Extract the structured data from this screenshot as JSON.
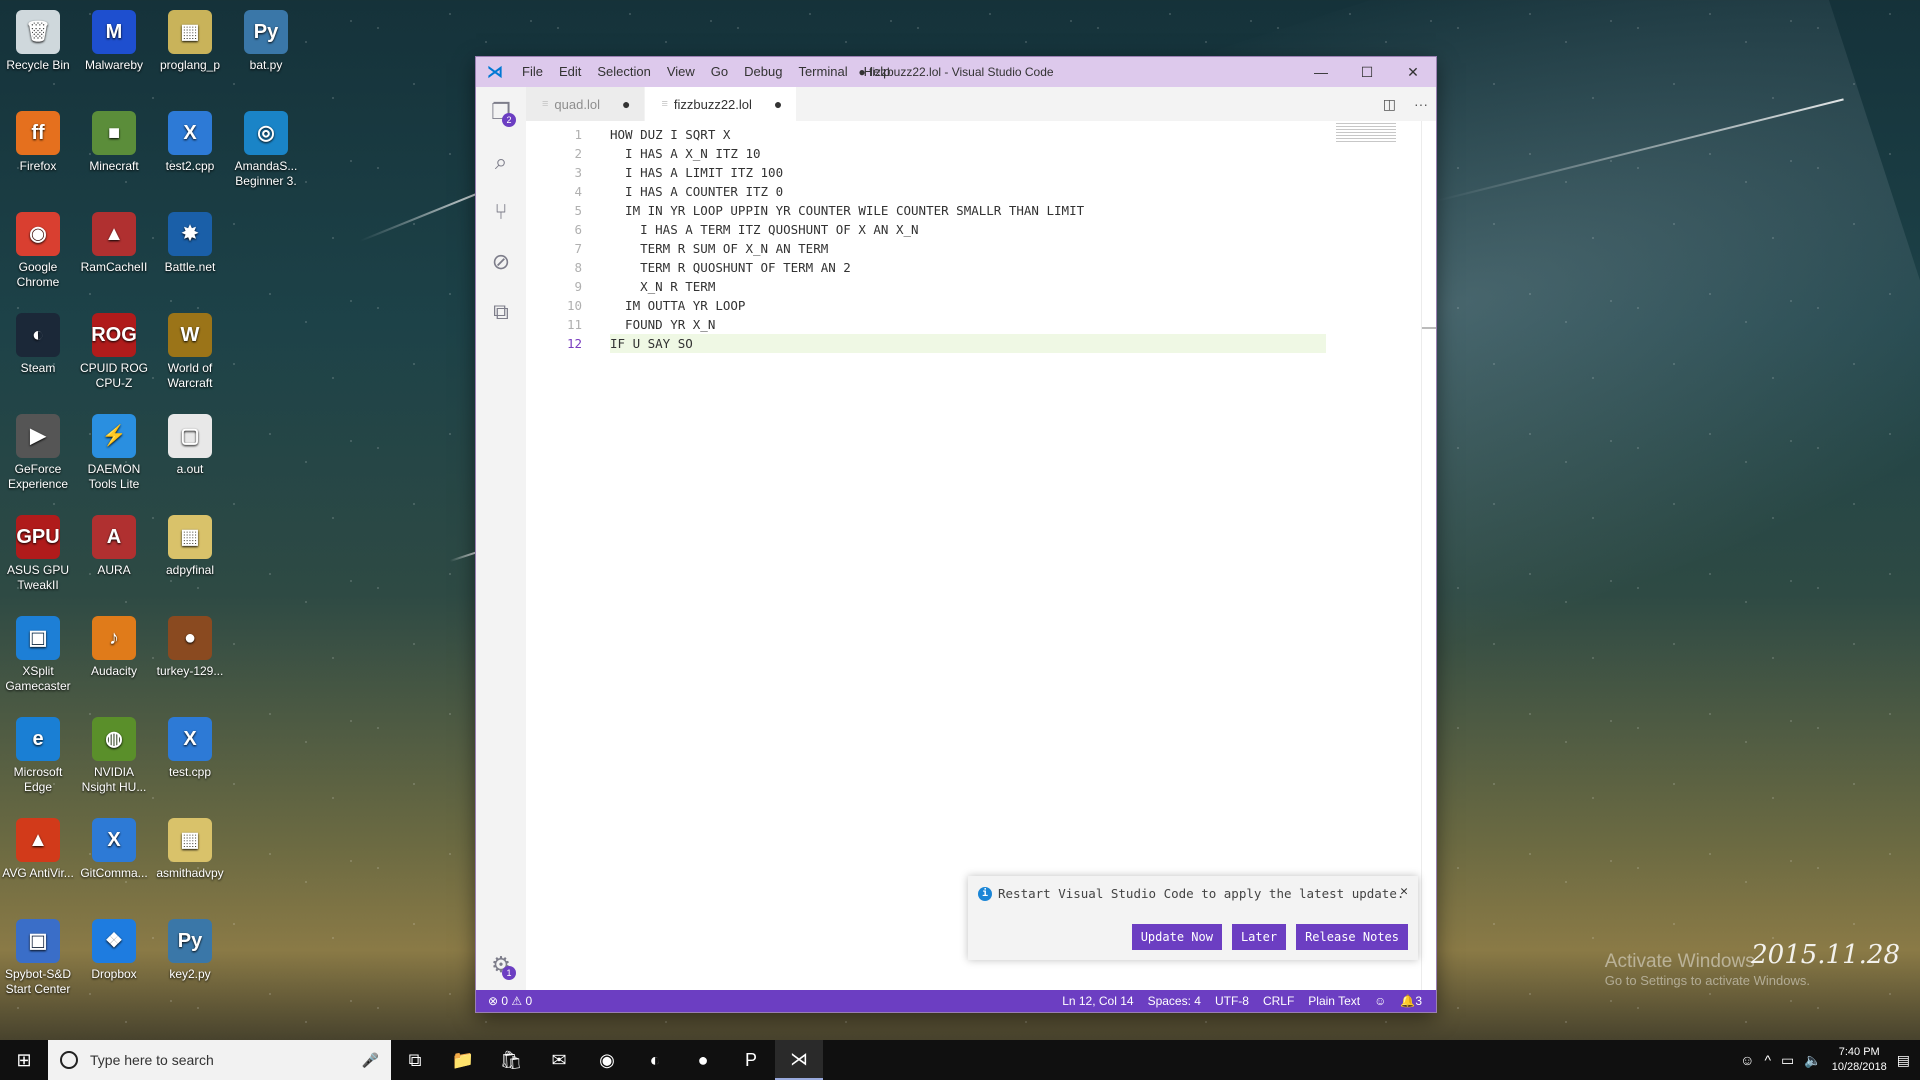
{
  "desktop": {
    "icons": [
      {
        "label": "Recycle Bin",
        "glyph": "🗑",
        "color": "#cfd8dc"
      },
      {
        "label": "Malwareby",
        "glyph": "M",
        "color": "#1e4fcf"
      },
      {
        "label": "proglang_p",
        "glyph": "▦",
        "color": "#c9b35a"
      },
      {
        "label": "bat.py",
        "glyph": "Py",
        "color": "#3a77a8"
      },
      {
        "label": "Firefox",
        "glyph": "ff",
        "color": "#e5701e"
      },
      {
        "label": "Minecraft",
        "glyph": "■",
        "color": "#5b8d3a"
      },
      {
        "label": "test2.cpp",
        "glyph": "X",
        "color": "#2d7ad6"
      },
      {
        "label": "AmandaS... Beginner 3.",
        "glyph": "◎",
        "color": "#1a84c7"
      },
      {
        "label": "Google Chrome",
        "glyph": "◉",
        "color": "#d93f30"
      },
      {
        "label": "RamCacheII",
        "glyph": "▲",
        "color": "#b03030"
      },
      {
        "label": "Battle.net",
        "glyph": "✸",
        "color": "#1a5fa8"
      },
      {
        "label": "",
        "glyph": "",
        "color": "transparent"
      },
      {
        "label": "Steam",
        "glyph": "◐",
        "color": "#1b2838"
      },
      {
        "label": "CPUID ROG CPU-Z",
        "glyph": "ROG",
        "color": "#b01b1b"
      },
      {
        "label": "World of Warcraft",
        "glyph": "W",
        "color": "#9b7418"
      },
      {
        "label": "",
        "glyph": "",
        "color": "transparent"
      },
      {
        "label": "GeForce Experience",
        "glyph": "▶",
        "color": "#555"
      },
      {
        "label": "DAEMON Tools Lite",
        "glyph": "⚡",
        "color": "#2a8fe0"
      },
      {
        "label": "a.out",
        "glyph": "▢",
        "color": "#e8e8e8"
      },
      {
        "label": "",
        "glyph": "",
        "color": "transparent"
      },
      {
        "label": "ASUS GPU TweakII",
        "glyph": "GPU",
        "color": "#b01b1b"
      },
      {
        "label": "AURA",
        "glyph": "A",
        "color": "#b03030"
      },
      {
        "label": "adpyfinal",
        "glyph": "▦",
        "color": "#d9c26a"
      },
      {
        "label": "",
        "glyph": "",
        "color": "transparent"
      },
      {
        "label": "XSplit Gamecaster",
        "glyph": "▣",
        "color": "#1d7fd6"
      },
      {
        "label": "Audacity",
        "glyph": "♪",
        "color": "#e07b1a"
      },
      {
        "label": "turkey-129...",
        "glyph": "●",
        "color": "#8a4a20"
      },
      {
        "label": "",
        "glyph": "",
        "color": "transparent"
      },
      {
        "label": "Microsoft Edge",
        "glyph": "e",
        "color": "#1a7fd4"
      },
      {
        "label": "NVIDIA Nsight HU...",
        "glyph": "◍",
        "color": "#5a8f2a"
      },
      {
        "label": "test.cpp",
        "glyph": "X",
        "color": "#2d7ad6"
      },
      {
        "label": "",
        "glyph": "",
        "color": "transparent"
      },
      {
        "label": "AVG AntiVir...",
        "glyph": "▲",
        "color": "#d23a1a"
      },
      {
        "label": "GitComma...",
        "glyph": "X",
        "color": "#2d7ad6"
      },
      {
        "label": "asmithadvpy",
        "glyph": "▦",
        "color": "#d9c26a"
      },
      {
        "label": "",
        "glyph": "",
        "color": "transparent"
      },
      {
        "label": "Spybot-S&D Start Center",
        "glyph": "▣",
        "color": "#3a6ec8"
      },
      {
        "label": "Dropbox",
        "glyph": "❖",
        "color": "#1e7ce0"
      },
      {
        "label": "key2.py",
        "glyph": "Py",
        "color": "#3a77a8"
      }
    ]
  },
  "window": {
    "logo": "⋊",
    "title": "● fizzbuzz22.lol - Visual Studio Code",
    "menu": [
      "File",
      "Edit",
      "Selection",
      "View",
      "Go",
      "Debug",
      "Terminal",
      "Help"
    ],
    "controls": {
      "minimize": "—",
      "maximize": "☐",
      "close": "✕"
    }
  },
  "activity": {
    "explorer_badge": "2",
    "settings_badge": "1"
  },
  "tabs": [
    {
      "name": "quad.lol",
      "dirty": "●",
      "active": false
    },
    {
      "name": "fizzbuzz22.lol",
      "dirty": "●",
      "active": true
    }
  ],
  "editor": {
    "current_line": 12,
    "lines": [
      "HOW DUZ I SQRT X",
      "  I HAS A X_N ITZ 10",
      "  I HAS A LIMIT ITZ 100",
      "  I HAS A COUNTER ITZ 0",
      "  IM IN YR LOOP UPPIN YR COUNTER WILE COUNTER SMALLR THAN LIMIT",
      "    I HAS A TERM ITZ QUOSHUNT OF X AN X_N",
      "    TERM R SUM OF X_N AN TERM",
      "    TERM R QUOSHUNT OF TERM AN 2",
      "    X_N R TERM",
      "  IM OUTTA YR LOOP",
      "  FOUND YR X_N",
      "IF U SAY SO"
    ]
  },
  "notification": {
    "message": "Restart Visual Studio Code to apply the latest update.",
    "buttons": [
      "Update Now",
      "Later",
      "Release Notes"
    ]
  },
  "statusbar": {
    "problems": "⊗ 0 ⚠ 0",
    "items": [
      "Ln 12, Col 14",
      "Spaces: 4",
      "UTF-8",
      "CRLF",
      "Plain Text",
      "☺",
      "🔔3"
    ]
  },
  "taskbar": {
    "search_placeholder": "Type here to search",
    "time": "7:40 PM",
    "date": "10/28/2018"
  },
  "watermark": {
    "line1": "Activate Windows",
    "line2": "Go to Settings to activate Windows."
  },
  "signature": "2015.11.28"
}
